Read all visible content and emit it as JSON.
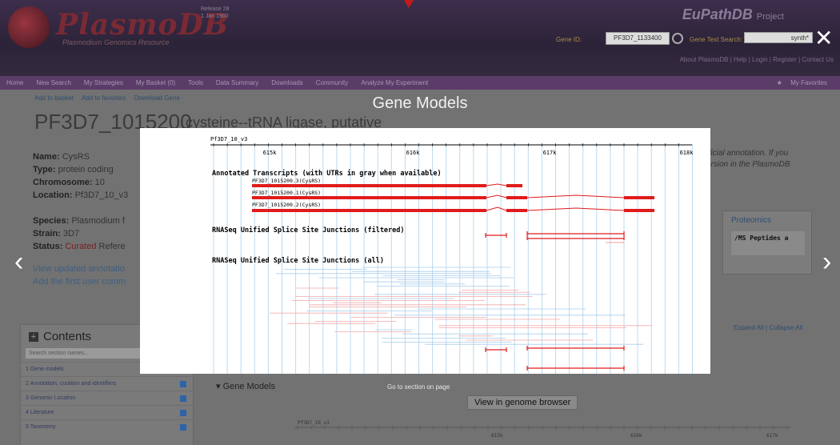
{
  "header": {
    "logo": "PlasmoDB",
    "logo_sub": "Plasmodium Genomics Resource",
    "release": "Release 28",
    "release_date": "1 Jan 1900",
    "project": "EuPathDB",
    "project_suffix": "Project",
    "gene_id_label": "Gene ID:",
    "gene_id_value": "PF3D7_1133400",
    "gene_text_label": "Gene Text Search:",
    "gene_text_value": "synth*",
    "toplinks": "About PlasmoDB  |  Help  |  Login  |  Register  |  Contact Us"
  },
  "nav": [
    "Home",
    "New Search",
    "My Strategies",
    "My Basket (0)",
    "Tools",
    "Data Summary",
    "Downloads",
    "Community",
    "Analyze My Experiment"
  ],
  "nav_favorites": "My Favorites",
  "page": {
    "add_basket": "Add to basket",
    "add_favorites": "Add to favorites",
    "download_gene": "Download Gene",
    "gene_id": "PF3D7_1015200",
    "gene_desc": "cysteine--tRNA ligase, putative",
    "name_label": "Name:",
    "name": "CysRS",
    "type_label": "Type:",
    "type": "protein coding",
    "chrom_label": "Chromosome:",
    "chrom": "10",
    "loc_label": "Location:",
    "loc": "Pf3D7_10_v3",
    "species_label": "Species:",
    "species": "Plasmodium f",
    "strain_label": "Strain:",
    "strain": "3D7",
    "status_label": "Status:",
    "status": "Curated",
    "status_rest": "Refere",
    "view_updated": "View updated annotatio",
    "add_comment": "Add the first user comm",
    "note_line1": "fficial annotation. If you",
    "note_line2": "ersion in the PlasmoDB",
    "proteomics": "Proteomics",
    "proteo_thumb": "/MS Peptides a",
    "expand_collapse": "Expand All | Collapse All",
    "contents_title": "Contents",
    "contents_search": "Search section names...",
    "toc": [
      "1 Gene models",
      "2 Annotation, curation and identifiers",
      "3 Genomic Location",
      "4 Literature",
      "5 Taxonomy"
    ],
    "gene_models_head": "Gene Models",
    "goto_section": "Go to section on page",
    "view_genome_browser": "View in genome browser"
  },
  "lightbox": {
    "title": "Gene Models",
    "close": "✕",
    "prev": "‹",
    "next": "›"
  },
  "gbrowse": {
    "ruler_label": "Pf3D7_10_v3",
    "ticks": [
      "615k",
      "616k",
      "617k",
      "618k"
    ],
    "track_transcripts": "Annotated Transcripts (with UTRs in gray when available)",
    "transcripts": [
      "PF3D7_1015200.3(CysRS)",
      "PF3D7_1015200.1(CysRS)",
      "PF3D7_1015200.2(CysRS)"
    ],
    "track_filtered": "RNASeq Unified Splice Site Junctions (filtered)",
    "track_all": "RNASeq Unified Splice Site Junctions (all)"
  },
  "colors": {
    "accent_red": "#e01b1b",
    "grid_blue": "#bcd9ef",
    "nav_purple": "#5b3c68"
  }
}
